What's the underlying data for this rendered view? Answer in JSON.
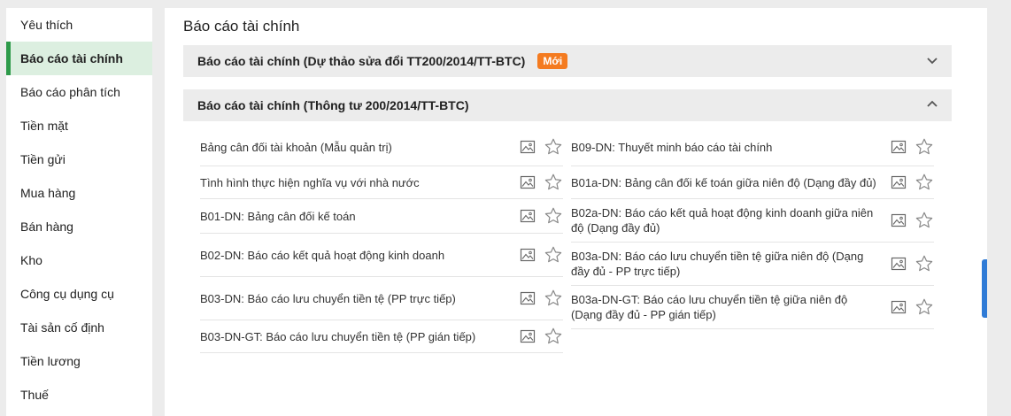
{
  "sidebar": {
    "items": [
      {
        "label": "Yêu thích"
      },
      {
        "label": "Báo cáo tài chính"
      },
      {
        "label": "Báo cáo phân tích"
      },
      {
        "label": "Tiền mặt"
      },
      {
        "label": "Tiền gửi"
      },
      {
        "label": "Mua hàng"
      },
      {
        "label": "Bán hàng"
      },
      {
        "label": "Kho"
      },
      {
        "label": "Công cụ dụng cụ"
      },
      {
        "label": "Tài sản cố định"
      },
      {
        "label": "Tiền lương"
      },
      {
        "label": "Thuế"
      }
    ],
    "active": "Báo cáo tài chính"
  },
  "main": {
    "title": "Báo cáo tài chính",
    "sections": [
      {
        "title": "Báo cáo tài chính (Dự thảo sửa đổi TT200/2014/TT-BTC)",
        "badge": "Mới",
        "expanded": false
      },
      {
        "title": "Báo cáo tài chính (Thông tư 200/2014/TT-BTC)",
        "expanded": true,
        "reports_left": [
          "Bảng cân đối tài khoản (Mẫu quản trị)",
          "Tình hình thực hiện nghĩa vụ với nhà nước",
          "B01-DN: Bảng cân đối kế toán",
          "B02-DN: Báo cáo kết quả hoạt động kinh doanh",
          "B03-DN: Báo cáo lưu chuyển tiền tệ (PP trực tiếp)",
          "B03-DN-GT: Báo cáo lưu chuyển tiền tệ (PP gián tiếp)"
        ],
        "reports_right": [
          "B09-DN: Thuyết minh báo cáo tài chính",
          "B01a-DN: Bảng cân đối kế toán giữa niên độ (Dạng đầy đủ)",
          "B02a-DN: Báo cáo kết quả hoạt động kinh doanh giữa niên độ (Dạng đầy đủ)",
          "B03a-DN: Báo cáo lưu chuyển tiền tệ giữa niên độ (Dạng đầy đủ - PP trực tiếp)",
          "B03a-DN-GT: Báo cáo lưu chuyển tiền tệ giữa niên độ (Dạng đầy đủ - PP gián tiếp)"
        ]
      }
    ]
  },
  "icons": {
    "report_preview": "image-icon",
    "favorite": "star-outline-icon",
    "collapse": "chevron-up-icon",
    "expand": "chevron-down-icon"
  },
  "colors": {
    "active_accent": "#2e9a4a",
    "active_bg": "#dcefe0",
    "badge": "#f47b20",
    "scroll_handle": "#2f7bd6"
  }
}
